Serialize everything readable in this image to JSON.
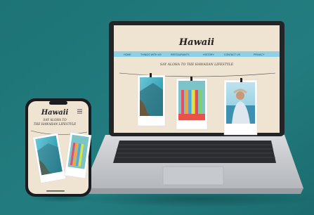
{
  "colors": {
    "background": "#21777a",
    "laptop_body": "#c9ccd0",
    "screen_bezel": "#222428",
    "page_bg": "#efe3d2",
    "nav_bar": "#8fd0e6",
    "brand_text": "#222222"
  },
  "laptop_site": {
    "brand": "Hawaii",
    "nav": [
      "HOME",
      "THINGS WITH US",
      "RESTAURANTS",
      "HISTORY",
      "CONTACT US",
      "PRIVACY"
    ],
    "tagline": "SAY ALOHA TO THE HAWAIIAN LIFESTYLE"
  },
  "phone_site": {
    "brand": "Hawaii",
    "tagline_line1": "SAY ALOHA TO",
    "tagline_line2": "THE HAWAIIAN LIFESTYLE"
  },
  "icons": [
    "nav-menu"
  ]
}
